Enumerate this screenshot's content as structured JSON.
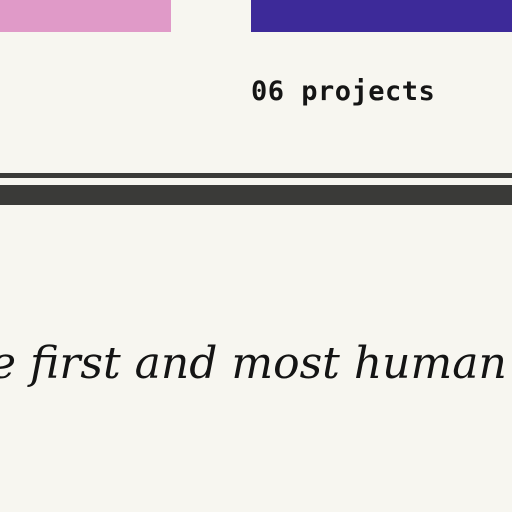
{
  "header": {
    "project_count": "06 projects"
  },
  "quote": {
    "text": "e first and most human of t"
  },
  "colors": {
    "background": "#f7f6f0",
    "pink_block": "#e09ac8",
    "indigo_block": "#3d2a99",
    "rule": "#3a3a38",
    "text": "#141414"
  }
}
